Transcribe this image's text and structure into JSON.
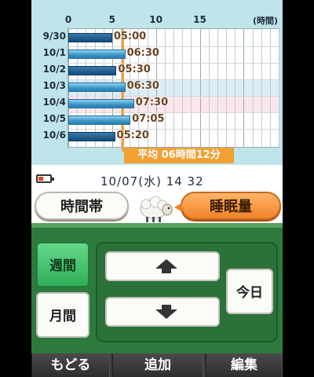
{
  "chart_data": {
    "type": "bar",
    "orientation": "horizontal",
    "x_ticks": [
      "0",
      "5",
      "10",
      "15"
    ],
    "x_unit": "(時間)",
    "xlim": [
      0,
      24
    ],
    "categories": [
      "9/30",
      "10/1",
      "10/2",
      "10/3",
      "10/4",
      "10/5",
      "10/6"
    ],
    "values": [
      5.0,
      6.5,
      5.5,
      6.5,
      7.5,
      7.0833,
      5.3333
    ],
    "value_labels": [
      "05:00",
      "06:30",
      "05:30",
      "06:30",
      "07:30",
      "07:05",
      "05:20"
    ],
    "average_hours": 6.2
  },
  "average": {
    "label": "平均 06時間12分"
  },
  "status": {
    "datetime": "10/07(水) 14  32",
    "battery_icon": "battery-low-icon"
  },
  "mode_buttons": {
    "timeband": "時間帯",
    "sleep": "睡眠量"
  },
  "range_buttons": {
    "week": "週間",
    "month": "月間",
    "today": "今日"
  },
  "footer": {
    "back": "もどる",
    "add": "追加",
    "edit": "編集"
  },
  "colors": {
    "accent": "#f2a032",
    "bar": "#3a95c7",
    "selected": "#2fae58"
  }
}
